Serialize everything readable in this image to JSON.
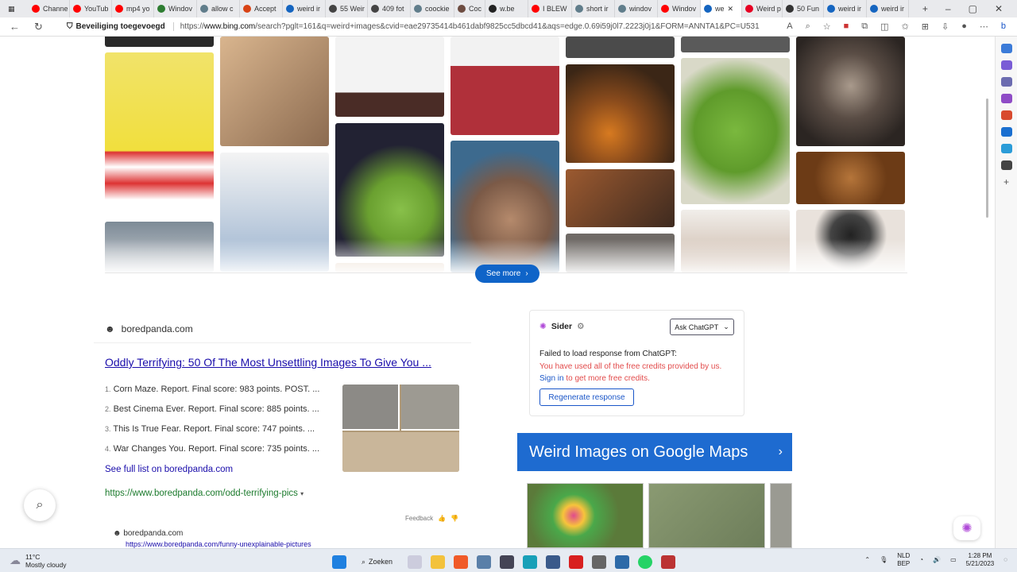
{
  "browser": {
    "tabs": [
      {
        "label": "Channe",
        "color": "#ff0000"
      },
      {
        "label": "YouTub",
        "color": "#ff0000"
      },
      {
        "label": "mp4 yo",
        "color": "#ff0000"
      },
      {
        "label": "Windov",
        "color": "#2e7d32"
      },
      {
        "label": "allow c",
        "color": "#607d8b"
      },
      {
        "label": "Accept",
        "color": "#d84315"
      },
      {
        "label": "weird ir",
        "color": "#1565c0"
      },
      {
        "label": "55 Weir",
        "color": "#444444"
      },
      {
        "label": "409 fot",
        "color": "#444444"
      },
      {
        "label": "coockie",
        "color": "#607d8b"
      },
      {
        "label": "Coc",
        "color": "#6d4c41"
      },
      {
        "label": "w.be",
        "color": "#222222"
      },
      {
        "label": "I BLEW",
        "color": "#ff0000"
      },
      {
        "label": "short ir",
        "color": "#607d8b"
      },
      {
        "label": "windov",
        "color": "#607d8b"
      },
      {
        "label": "Windov",
        "color": "#ff0000"
      },
      {
        "label": "we",
        "color": "#1565c0",
        "active": true
      },
      {
        "label": "Weird p",
        "color": "#e60023"
      },
      {
        "label": "50 Fun",
        "color": "#333333"
      },
      {
        "label": "weird ir",
        "color": "#1565c0"
      },
      {
        "label": "weird ir",
        "color": "#1565c0"
      }
    ],
    "security_label": "Beveiliging toegevoegd",
    "url_prefix": "https://",
    "url_host": "www.bing.com",
    "url_rest": "/search?pglt=161&q=weird+images&cvid=eae29735414b461dabf9825cc5dbcd41&aqs=edge.0.69i59j0l7.2223j0j1&FORM=ANNTA1&PC=U531"
  },
  "images": {
    "see_more_label": "See more"
  },
  "result": {
    "site": "boredpanda.com",
    "title": "Oddly Terrifying: 50 Of The Most Unsettling Images To Give You ...",
    "items": [
      {
        "num": "1.",
        "text": "Corn Maze. Report. Final score: 983 points. POST. ..."
      },
      {
        "num": "2.",
        "text": "Best Cinema Ever. Report. Final score: 885 points. ..."
      },
      {
        "num": "3.",
        "text": "This Is True Fear. Report. Final score: 747 points. ..."
      },
      {
        "num": "4.",
        "text": "War Changes You. Report. Final score: 735 points. ..."
      }
    ],
    "see_full": "See full list on boredpanda.com",
    "url": "https://www.boredpanda.com/odd-terrifying-pics",
    "feedback": "Feedback",
    "next_site": "boredpanda.com",
    "next_url": "https://www.boredpanda.com/funny-unexplainable-pictures"
  },
  "sider": {
    "name": "Sider",
    "ask_label": "Ask ChatGPT",
    "msg_line1": "Failed to load response from ChatGPT:",
    "msg_line2": "You have used all of the free credits provided by us.",
    "msg_sign": "Sign in",
    "msg_line3": " to get more free credits.",
    "regen_label": "Regenerate response"
  },
  "maps": {
    "title": "Weird Images on Google Maps"
  },
  "taskbar": {
    "temp": "11°C",
    "weather": "Mostly cloudy",
    "search_label": "Zoeken",
    "lang1": "NLD",
    "lang2": "BEP",
    "time": "1:28 PM",
    "date": "5/21/2023"
  }
}
